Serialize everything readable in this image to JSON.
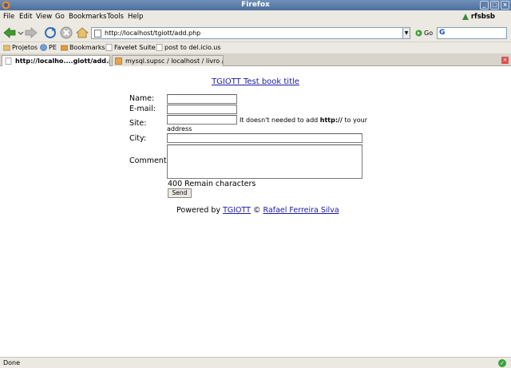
{
  "window": {
    "title": "Firefox"
  },
  "menu": {
    "items": [
      "File",
      "Edit",
      "View",
      "Go",
      "Bookmarks",
      "Tools",
      "Help"
    ],
    "user": "rfsbsb"
  },
  "nav": {
    "url": "http://localhost/tgiott/add.php",
    "go_label": "Go",
    "search_value": ""
  },
  "bookmarks": [
    "Projetos",
    "PE",
    "Bookmarks",
    "Favelet Suite",
    "post to del.icio.us"
  ],
  "tabs": [
    {
      "label": "http://localho....giott/add.php",
      "active": true
    },
    {
      "label": "mysql.supsc / localhost / livro  /  |...",
      "active": false
    }
  ],
  "page": {
    "title": "TGIOTT Test book title",
    "form": {
      "name_label": "Name:",
      "email_label": "E-mail:",
      "site_label": "Site:",
      "site_hint_pre": "It doesn't needed to add",
      "site_hint_bold": "http://",
      "site_hint_post": "to your",
      "site_hint_line2": "address",
      "city_label": "City:",
      "comment_label": "Comment:",
      "remain": "400 Remain characters",
      "send_label": "Send"
    },
    "footer": {
      "powered": "Powered by",
      "link1": "TGIOTT",
      "copy": "©",
      "link2": "Rafael Ferreira Silva"
    }
  },
  "status": {
    "text": "Done"
  },
  "colors": {
    "link": "#1a1aa6",
    "titlebar": "#5a7aa8"
  }
}
